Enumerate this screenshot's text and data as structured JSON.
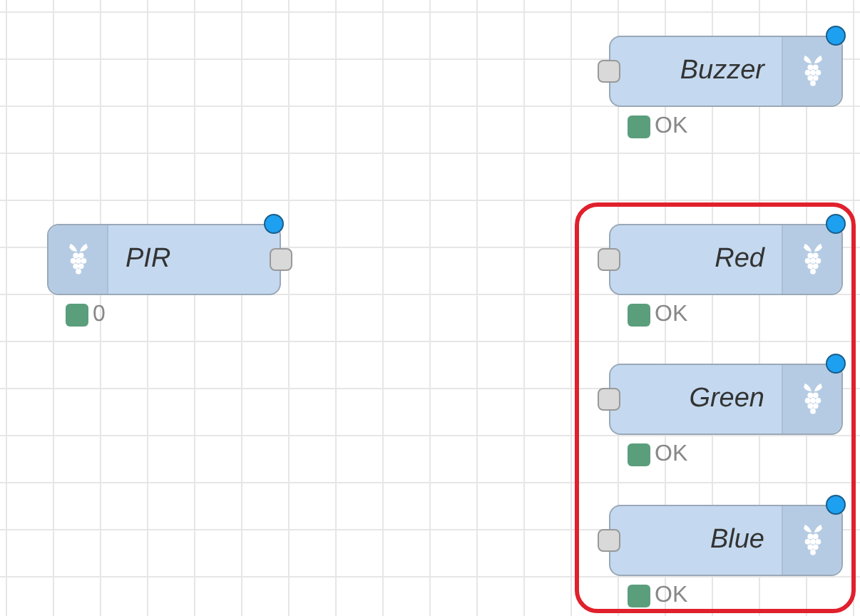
{
  "nodes": [
    {
      "kind": "input",
      "label": "PIR",
      "changed": true,
      "status": {
        "text": "0",
        "color": "#5a9e7c"
      }
    },
    {
      "kind": "output",
      "label": "Buzzer",
      "changed": true,
      "status": {
        "text": "OK",
        "color": "#5a9e7c"
      }
    },
    {
      "kind": "output",
      "label": "Red",
      "changed": true,
      "status": {
        "text": "OK",
        "color": "#5a9e7c"
      }
    },
    {
      "kind": "output",
      "label": "Green",
      "changed": true,
      "status": {
        "text": "OK",
        "color": "#5a9e7c"
      }
    },
    {
      "kind": "output",
      "label": "Blue",
      "changed": true,
      "status": {
        "text": "OK",
        "color": "#5a9e7c"
      }
    }
  ],
  "highlight": {
    "shown": true
  }
}
